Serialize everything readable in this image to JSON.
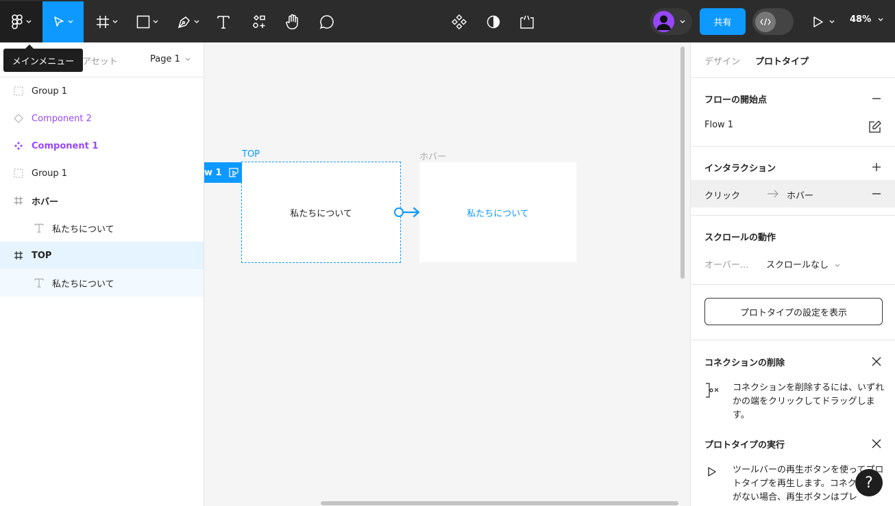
{
  "toolbar": {
    "share_label": "共有",
    "zoom": "48%",
    "tooltip": "メインメニュー"
  },
  "left_panel": {
    "tab_assets": "アセット",
    "page": "Page 1",
    "layers": [
      {
        "name": "Group 1",
        "type": "group"
      },
      {
        "name": "Component 2",
        "type": "component-instance"
      },
      {
        "name": "Component 1",
        "type": "component"
      },
      {
        "name": "Group 1",
        "type": "group"
      },
      {
        "name": "ホバー",
        "type": "frame"
      },
      {
        "name": "私たちについて",
        "type": "text"
      },
      {
        "name": "TOP",
        "type": "frame"
      },
      {
        "name": "私たちについて",
        "type": "text"
      }
    ]
  },
  "canvas": {
    "flow_tag": "w 1",
    "frame_top": {
      "label": "TOP",
      "text": "私たちについて"
    },
    "frame_hover": {
      "label": "ホバー",
      "text": "私たちについて"
    }
  },
  "right_panel": {
    "tab_design": "デザイン",
    "tab_prototype": "プロトタイプ",
    "flow_section": {
      "title": "フローの開始点",
      "flow_name": "Flow 1"
    },
    "interaction_section": {
      "title": "インタラクション",
      "trigger": "クリック",
      "destination": "ホバー"
    },
    "scroll_section": {
      "title": "スクロールの動作",
      "label": "オーバー...",
      "value": "スクロールなし"
    },
    "settings_button": "プロトタイプの設定を表示",
    "delete_connection": {
      "title": "コネクションの削除",
      "text": "コネクションを削除するには、いずれかの端をクリックしてドラッグします。"
    },
    "run_prototype": {
      "title": "プロトタイプの実行",
      "text": "ツールバーの再生ボタンを使ってプロトタイプを再生します。コネクションがない場合、再生ボタンはプレ"
    }
  },
  "help_label": "?",
  "colors": {
    "accent": "#0d99ff",
    "component": "#9747ff",
    "toolbar": "#2c2c2c"
  }
}
